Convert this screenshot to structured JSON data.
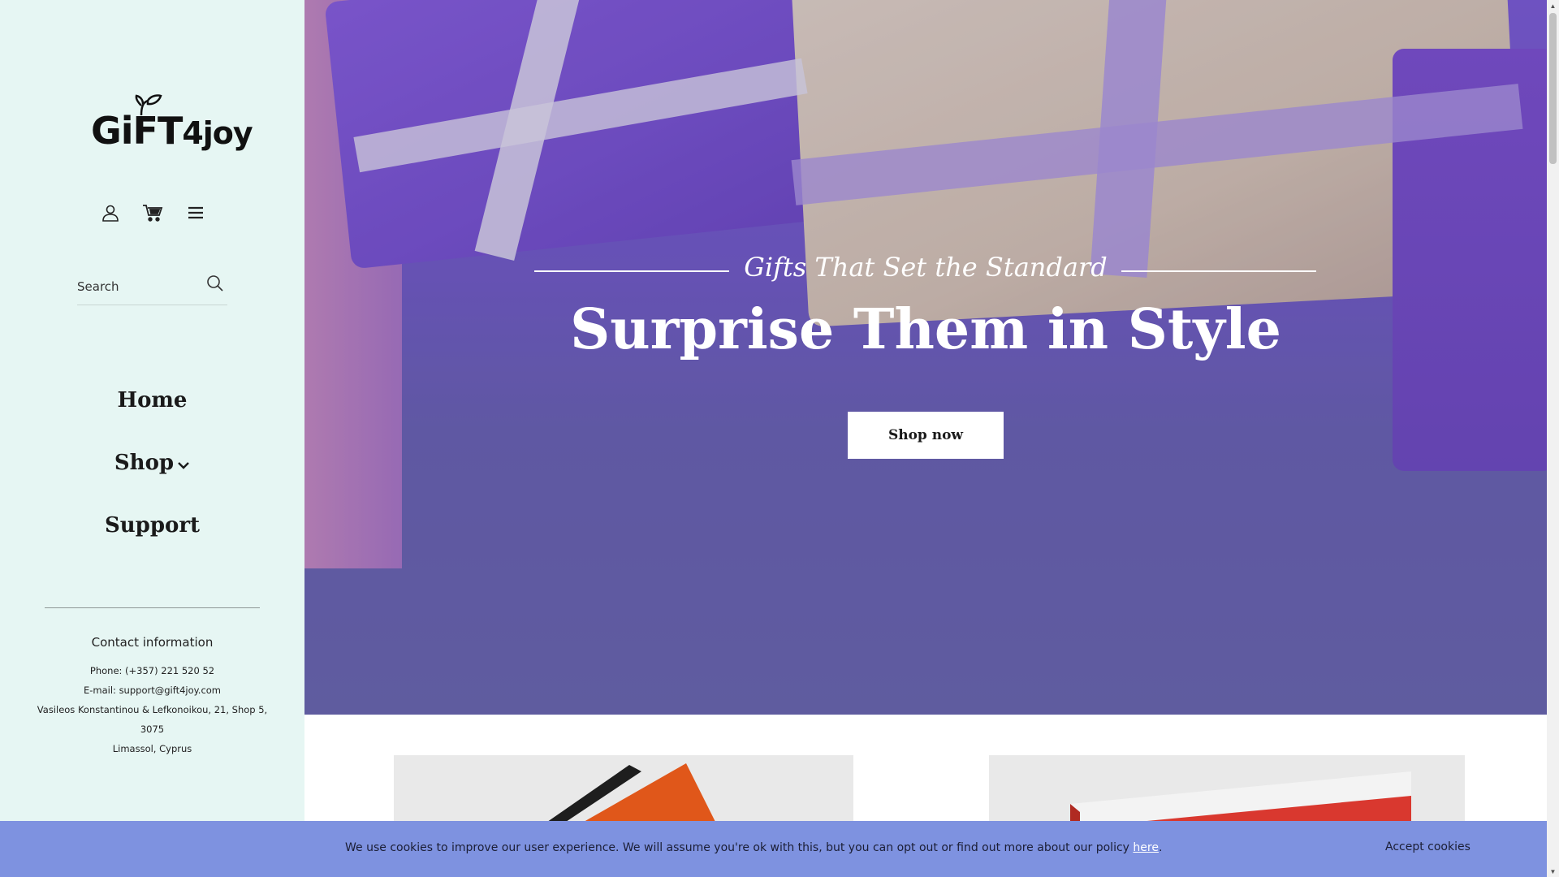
{
  "brand": {
    "logo_text_main": "GiFT",
    "logo_text_num": "4joy"
  },
  "header_icons": {
    "account": "user-icon",
    "cart": "cart-icon",
    "menu": "menu-icon"
  },
  "search": {
    "placeholder": "Search",
    "icon": "search-icon"
  },
  "nav": {
    "items": [
      {
        "label": "Home"
      },
      {
        "label": "Shop"
      },
      {
        "label": "Support"
      }
    ]
  },
  "contact": {
    "heading": "Contact information",
    "phone": "Phone: (+357) 221 520 52",
    "email": "E-mail: support@gift4joy.com",
    "address_line1": "Vasileos Konstantinou & Lefkonoikou, 21, Shop 5,",
    "address_line2": "3075",
    "address_line3": "Limassol, Cyprus"
  },
  "hero": {
    "subtitle": "Gifts That Set the Standard",
    "title": "Surprise Them in Style",
    "button_label": "Shop now"
  },
  "cookie": {
    "message": "We use cookies to improve our user experience. We will assume you're ok with this, but you can opt out or find out more about our policy ",
    "link_text": "here",
    "suffix": ".",
    "accept_label": "Accept cookies"
  },
  "colors": {
    "sidebar_bg": "#e6f6f3",
    "cookie_bg": "#7e92e0",
    "hero_purple": "#735ac8"
  }
}
